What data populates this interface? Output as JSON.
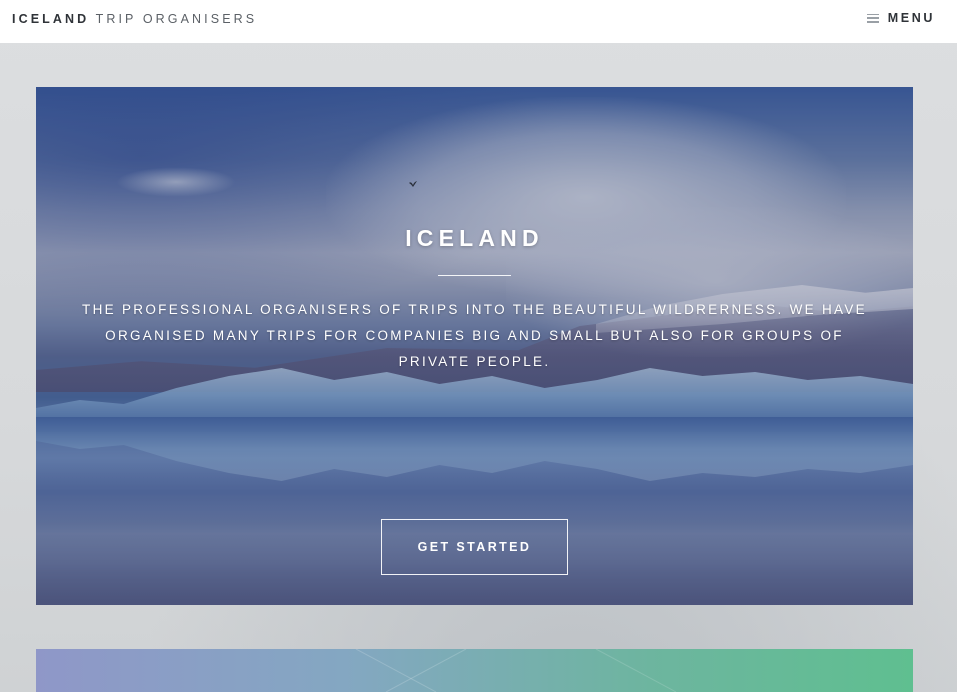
{
  "nav": {
    "brand_strong": "ICELAND",
    "brand_light": "TRIP ORGANISERS",
    "menu_label": "MENU",
    "menu_icon": "hamburger-icon"
  },
  "hero": {
    "title": "ICELAND",
    "description": "THE PROFESSIONAL ORGANISERS OF TRIPS INTO THE BEAUTIFUL WILDRERNESS. WE HAVE ORGANISED MANY TRIPS FOR COMPANIES BIG AND SMALL BUT ALSO FOR GROUPS OF PRIVATE PEOPLE.",
    "cta_label": "GET STARTED",
    "background_image": "iceland-glacier-lagoon"
  },
  "colors": {
    "nav_background": "#ffffff",
    "brand_text": "#2f3338",
    "page_background": "#dcdee0",
    "hero_text": "#ffffff",
    "teaser_gradient_start": "#8f97c8",
    "teaser_gradient_end": "#5fbf90"
  }
}
